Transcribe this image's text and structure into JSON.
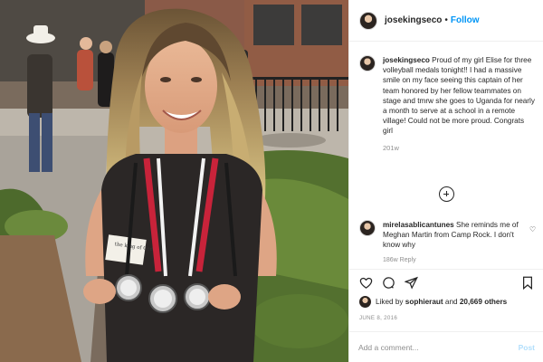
{
  "post": {
    "username": "josekingseco",
    "follow_label": "Follow",
    "separator": "•",
    "caption_text": "Proud of my girl Elise for three volleyball medals tonight!! I had a massive smile on my face seeing this captain of her team honored by her fellow teammates on stage and tmrw she goes to Uganda for nearly a month to serve at a school in a remote village! Could not be more proud. Congrats girl",
    "caption_time": "201w",
    "comments": [
      {
        "username": "mirelasablicantunes",
        "text": "She reminds me of Meghan Martin from Camp Rock. I don't know why",
        "meta": "186w   Reply"
      }
    ],
    "likes": {
      "prefix": "Liked by",
      "user": "sophieraut",
      "middle": "and",
      "count": "20,669 others"
    },
    "date": "JUNE 8, 2016",
    "add_comment_placeholder": "Add a comment...",
    "post_label": "Post",
    "photo_text": {
      "name_tag": "the king of Cedar"
    }
  },
  "icons": {
    "more": "plus-circle-icon",
    "like": "heart-icon",
    "comment": "comment-icon",
    "share": "paper-plane-icon",
    "save": "bookmark-icon"
  },
  "colors": {
    "link": "#0095f6",
    "muted": "#8e8e8e",
    "post_disabled": "#b2dffc",
    "text": "#262626"
  }
}
